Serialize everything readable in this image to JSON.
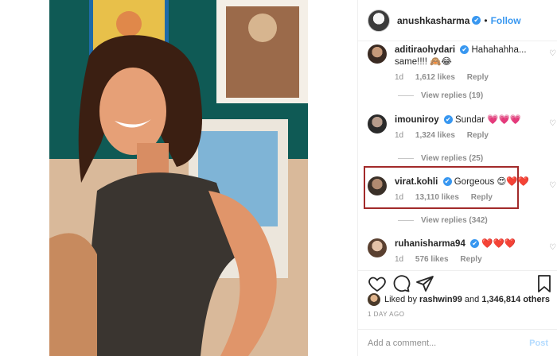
{
  "post": {
    "username": "anushkasharma",
    "verified_mark": "✔",
    "dot": "•",
    "follow_label": "Follow"
  },
  "comments": [
    {
      "username": "aditiraohydari",
      "verified": true,
      "text": "Hahahahha... same!!!! 🙈😂",
      "time": "1d",
      "likes": "1,612 likes",
      "reply": "Reply",
      "view_replies": "View replies (19)"
    },
    {
      "username": "imouniroy",
      "verified": true,
      "text": "Sundar 💗💗💗",
      "time": "1d",
      "likes": "1,324 likes",
      "reply": "Reply",
      "view_replies": "View replies (25)"
    },
    {
      "username": "virat.kohli",
      "verified": true,
      "text": "Gorgeous 😍❤️❤️",
      "time": "1d",
      "likes": "13,110 likes",
      "reply": "Reply",
      "view_replies": "View replies (342)"
    },
    {
      "username": "ruhanisharma94",
      "verified": true,
      "text": "❤️❤️❤️",
      "time": "1d",
      "likes": "576 likes",
      "reply": "Reply"
    }
  ],
  "actions": {
    "icons": [
      "heart-icon",
      "comment-icon",
      "share-icon",
      "bookmark-icon"
    ],
    "liked_by_prefix": "Liked by",
    "liked_by_user": "rashwin99",
    "liked_by_and": "and",
    "liked_by_count": "1,346,814 others",
    "timestamp": "1 DAY AGO"
  },
  "composer": {
    "placeholder": "Add a comment...",
    "post_label": "Post"
  },
  "colors": {
    "accent": "#3897f0",
    "highlight_border": "#a22a2a",
    "muted": "#8e8e8e"
  }
}
